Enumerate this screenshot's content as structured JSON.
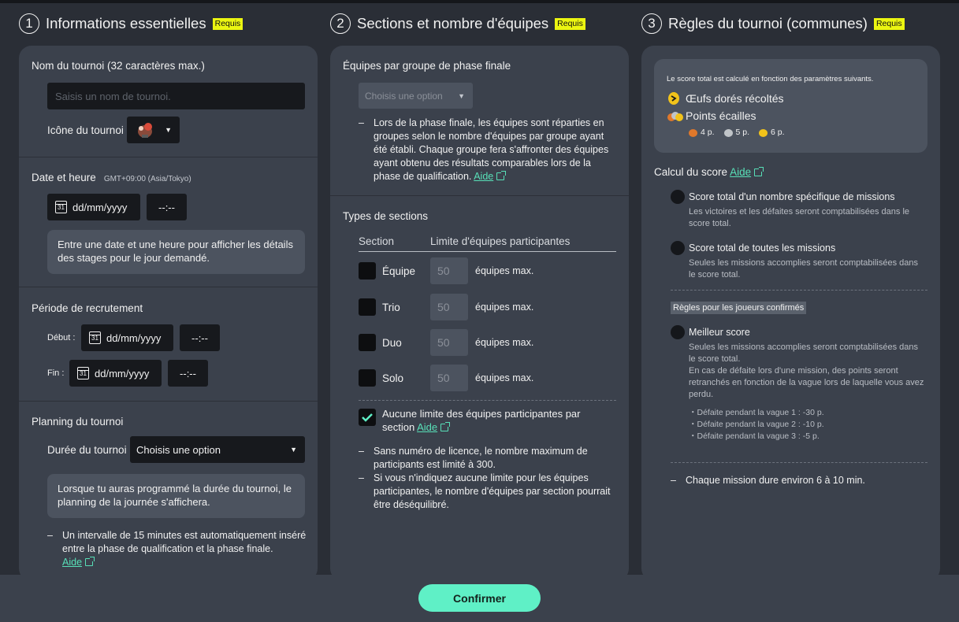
{
  "required_badge": "Requis",
  "col1": {
    "num": "1",
    "title": "Informations essentielles",
    "name_label": "Nom du tournoi (32 caractères max.)",
    "name_placeholder": "Saisis un nom de tournoi.",
    "icon_label": "Icône du tournoi",
    "date_label": "Date et heure",
    "tz": "GMT+09:00 (Asia/Tokyo)",
    "date_ph": "dd/mm/yyyy",
    "time_ph": "--:--",
    "date_info": "Entre une date et une heure pour afficher les détails des stages pour le jour demandé.",
    "recruit_label": "Période de recrutement",
    "start_label": "Début :",
    "end_label": "Fin :",
    "planning_label": "Planning du tournoi",
    "duration_label": "Durée du tournoi",
    "duration_value": "Choisis une option",
    "planning_info": "Lorsque tu auras programmé la durée du tournoi, le planning de la journée s'affichera.",
    "interval_note": "Un intervalle de 15 minutes est automatiquement inséré entre la phase de qualification et la phase finale.",
    "help": "Aide"
  },
  "col2": {
    "num": "2",
    "title": "Sections et nombre d'équipes",
    "group_label": "Équipes par groupe de phase finale",
    "group_select": "Choisis une option",
    "group_note": "Lors de la phase finale, les équipes sont réparties en groupes selon le nombre d'équipes par groupe ayant été établi. Chaque groupe fera s'affronter des équipes ayant obtenu des résultats comparables lors de la phase de qualification.",
    "help": "Aide",
    "types_label": "Types de sections",
    "th_section": "Section",
    "th_limit": "Limite d'équipes participantes",
    "rows": [
      {
        "name": "Équipe",
        "value": "50",
        "unit": "équipes max."
      },
      {
        "name": "Trio",
        "value": "50",
        "unit": "équipes max."
      },
      {
        "name": "Duo",
        "value": "50",
        "unit": "équipes max."
      },
      {
        "name": "Solo",
        "value": "50",
        "unit": "équipes max."
      }
    ],
    "nolimit": "Aucune limite des équipes participantes par section",
    "note1": "Sans numéro de licence, le nombre maximum de participants est limité à 300.",
    "note2": "Si vous n'indiquez aucune limite pour les équipes participantes, le nombre d'équipes par section pourrait être déséquilibré."
  },
  "col3": {
    "num": "3",
    "title": "Règles du tournoi (communes)",
    "score_info": "Le score total est calculé en fonction des paramètres suivants.",
    "eggs": "Œufs dorés récoltés",
    "scales": "Points écailles",
    "s1": "4 p.",
    "s2": "5 p.",
    "s3": "6 p.",
    "calc_label": "Calcul du score",
    "help": "Aide",
    "opt1_title": "Score total d'un nombre spécifique de missions",
    "opt1_desc": "Les victoires et les défaites seront comptabilisées dans le score total.",
    "opt2_title": "Score total de toutes les missions",
    "opt2_desc": "Seules les missions accomplies seront comptabilisées dans le score total.",
    "confirmed_tag": "Règles pour les joueurs confirmés",
    "opt3_title": "Meilleur score",
    "opt3_desc1": "Seules les missions accomplies seront comptabilisées dans le score total.",
    "opt3_desc2": "En cas de défaite lors d'une mission, des points seront retranchés en fonction de la vague lors de laquelle vous avez perdu.",
    "bullet1": "・Défaite pendant la vague 1 : -30 p.",
    "bullet2": "・Défaite pendant la vague 2 : -10 p.",
    "bullet3": "・Défaite pendant la vague 3 :   -5 p.",
    "duration_note": "Chaque mission dure environ 6 à 10 min."
  },
  "confirm": "Confirmer",
  "colors": {
    "accent": "#5ff0c6",
    "required": "#ebf511",
    "panel": "#3b414c",
    "bg": "#2a2e36"
  }
}
